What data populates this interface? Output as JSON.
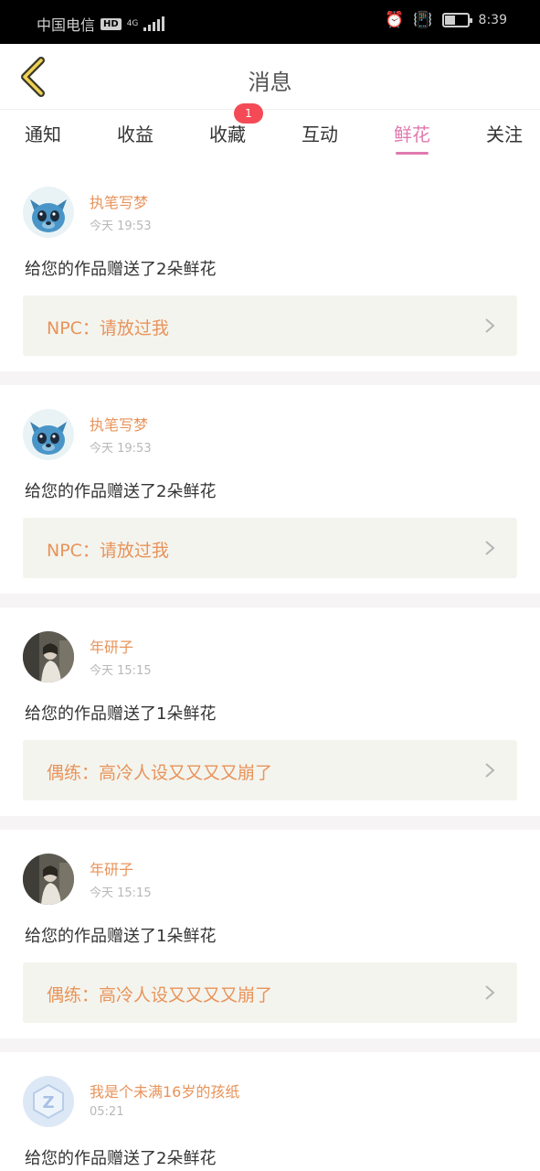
{
  "status_bar": {
    "carrier": "中国电信",
    "hd": "HD",
    "network": "4G",
    "time": "8:39",
    "battery_level": 0.45,
    "icons": [
      "alarm-icon",
      "vibrate-icon"
    ]
  },
  "header": {
    "title": "消息",
    "back_icon": "chevron-left-icon"
  },
  "tabs": [
    {
      "label": "通知",
      "active": false
    },
    {
      "label": "收益",
      "active": false
    },
    {
      "label": "收藏",
      "active": false,
      "badge": "1"
    },
    {
      "label": "互动",
      "active": false
    },
    {
      "label": "鲜花",
      "active": true
    },
    {
      "label": "关注",
      "active": false
    }
  ],
  "colors": {
    "accent": "#e07ab0",
    "username": "#e8935a",
    "badge": "#f44a55",
    "work_box_bg": "#f4f4ee"
  },
  "messages": [
    {
      "username": "执笔写梦",
      "time": "今天 19:53",
      "text": "给您的作品赠送了2朵鲜花",
      "work": "NPC：请放过我",
      "avatar": "stitch-avatar"
    },
    {
      "username": "执笔写梦",
      "time": "今天 19:53",
      "text": "给您的作品赠送了2朵鲜花",
      "work": "NPC：请放过我",
      "avatar": "stitch-avatar"
    },
    {
      "username": "年研子",
      "time": "今天 15:15",
      "text": "给您的作品赠送了1朵鲜花",
      "work": "偶练：高冷人设又又又又崩了",
      "avatar": "photo-avatar"
    },
    {
      "username": "年研子",
      "time": "今天 15:15",
      "text": "给您的作品赠送了1朵鲜花",
      "work": "偶练：高冷人设又又又又崩了",
      "avatar": "photo-avatar"
    },
    {
      "username": "我是个未满16岁的孩纸",
      "time": "05:21",
      "text": "给您的作品赠送了2朵鲜花",
      "avatar": "default-avatar"
    }
  ]
}
